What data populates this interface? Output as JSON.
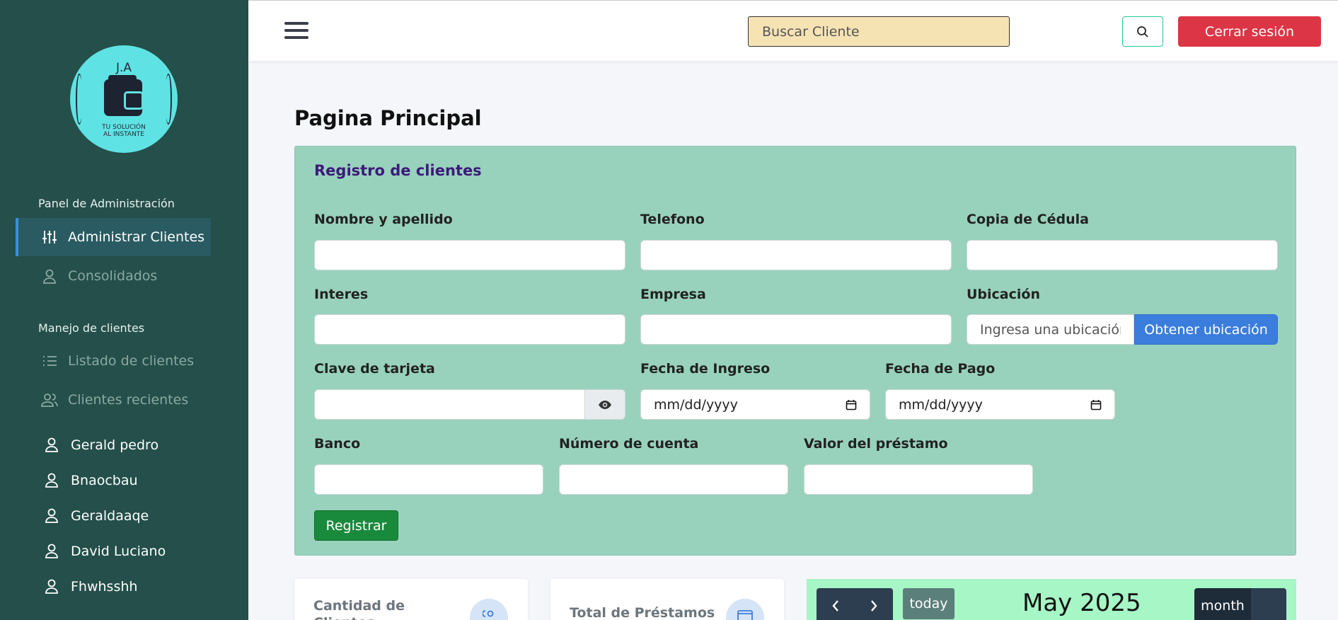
{
  "brand": {
    "initials": "J.A",
    "slogan_line1": "TU SOLUCIÓN",
    "slogan_line2": "AL INSTANTE"
  },
  "sidebar": {
    "section1_title": "Panel de Administración",
    "section1_items": [
      {
        "label": "Administrar Clientes",
        "icon": "sliders-icon",
        "active": true
      },
      {
        "label": "Consolidados",
        "icon": "user-icon",
        "active": false
      }
    ],
    "section2_title": "Manejo de clientes",
    "section2_items": [
      {
        "label": "Listado de clientes",
        "icon": "list-icon"
      },
      {
        "label": "Clientes recientes",
        "icon": "users-icon"
      }
    ],
    "clients": [
      "Gerald pedro",
      "Bnaocbau",
      "Geraldaaqe",
      "David Luciano",
      "Fhwhsshh"
    ]
  },
  "header": {
    "search_placeholder": "Buscar Cliente",
    "logout_label": "Cerrar sesión"
  },
  "main": {
    "title_bold": "Pagina",
    "title_rest": " Principal",
    "form": {
      "title": "Registro de clientes",
      "nombre_label": "Nombre y apellido",
      "telefono_label": "Telefono",
      "cedula_label": "Copia de Cédula",
      "interes_label": "Interes",
      "empresa_label": "Empresa",
      "ubicacion_label": "Ubicación",
      "ubicacion_placeholder": "Ingresa una ubicación",
      "ubicacion_button": "Obtener ubicación",
      "clave_label": "Clave de tarjeta",
      "fecha_ingreso_label": "Fecha de Ingreso",
      "fecha_ingreso_value": "mm/dd/yyyy",
      "fecha_pago_label": "Fecha de Pago",
      "fecha_pago_value": "mm/dd/yyyy",
      "banco_label": "Banco",
      "cuenta_label": "Número de cuenta",
      "valor_label": "Valor del préstamo",
      "submit_label": "Registrar"
    },
    "stats": [
      {
        "label_line1": "Cantidad de",
        "label_line2": "Clientes"
      },
      {
        "label_line1": "Total de Préstamos",
        "label_line2": ""
      }
    ],
    "calendar": {
      "today_label": "today",
      "month_title": "May 2025",
      "view_label": "month"
    }
  },
  "colors": {
    "sidebar_bg": "#244f4a",
    "form_bg": "#98d2bd",
    "logout": "#dc3545",
    "search_bg": "#f6e3b4",
    "location_button": "#3b7ddd",
    "register_button": "#198a3c",
    "calendar_bg": "#a6f6c6"
  }
}
